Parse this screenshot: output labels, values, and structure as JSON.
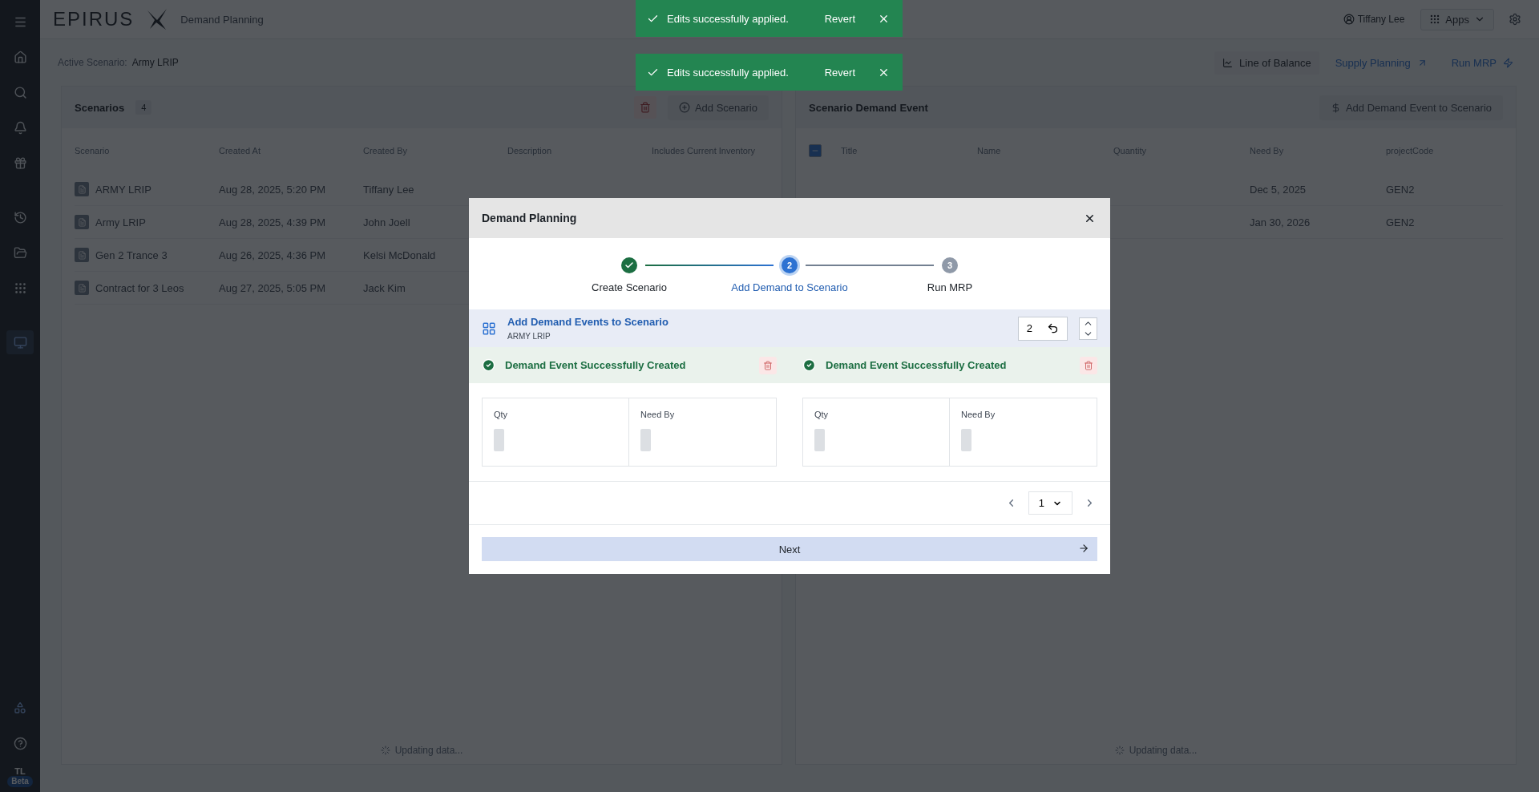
{
  "app": {
    "logo": "EPIRUS",
    "title": "Demand Planning",
    "user": "Tiffany Lee",
    "apps_label": "Apps",
    "avatar": "TL",
    "avatar_badge": "Beta"
  },
  "toasts": [
    {
      "message": "Edits successfully applied.",
      "action": "Revert"
    },
    {
      "message": "Edits successfully applied.",
      "action": "Revert"
    }
  ],
  "subheader": {
    "label": "Active Scenario:",
    "value": "Army LRIP",
    "actions": [
      "Line of Balance",
      "Supply Planning",
      "Run MRP"
    ]
  },
  "scenarios": {
    "title": "Scenarios",
    "count": "4",
    "add_label": "Add Scenario",
    "columns": [
      "Scenario",
      "Created At",
      "Created By",
      "Description",
      "Includes Current Inventory"
    ],
    "rows": [
      {
        "name": "ARMY LRIP",
        "created_at": "Aug 28, 2025, 5:20 PM",
        "created_by": "Tiffany Lee"
      },
      {
        "name": "Army LRIP",
        "created_at": "Aug 28, 2025, 4:39 PM",
        "created_by": "John Joell"
      },
      {
        "name": "Gen 2 Trance 3",
        "created_at": "Aug 26, 2025, 4:36 PM",
        "created_by": "Kelsi McDonald"
      },
      {
        "name": "Contract for 3 Leos",
        "created_at": "Aug 27, 2025, 5:05 PM",
        "created_by": "Jack Kim"
      }
    ],
    "status": "Updating data..."
  },
  "demand_events": {
    "title": "Scenario Demand Event",
    "add_label": "Add Demand Event to Scenario",
    "partial_selection": true,
    "columns": [
      "Title",
      "Name",
      "Quantity",
      "Need By",
      "projectCode"
    ],
    "rows": [
      {
        "need_by": "Dec 5, 2025",
        "project_code": "GEN2"
      },
      {
        "need_by": "Jan 30, 2026",
        "project_code": "GEN2"
      }
    ],
    "status": "Updating data..."
  },
  "modal": {
    "title": "Demand Planning",
    "steps": [
      {
        "label": "Create Scenario",
        "done": true,
        "selected": false
      },
      {
        "number": "2",
        "label": "Add Demand to Scenario",
        "done": false,
        "selected": true
      },
      {
        "number": "3",
        "label": "Run MRP",
        "done": false,
        "selected": false
      }
    ],
    "section_title": "Add Demand Events to Scenario",
    "section_subtitle": "ARMY LRIP",
    "count_value": "2",
    "events": [
      {
        "message": "Demand Event Successfully Created",
        "qty_label": "Qty",
        "need_by_label": "Need By"
      },
      {
        "message": "Demand Event Successfully Created",
        "qty_label": "Qty",
        "need_by_label": "Need By"
      }
    ],
    "page": "1",
    "next_label": "Next"
  }
}
